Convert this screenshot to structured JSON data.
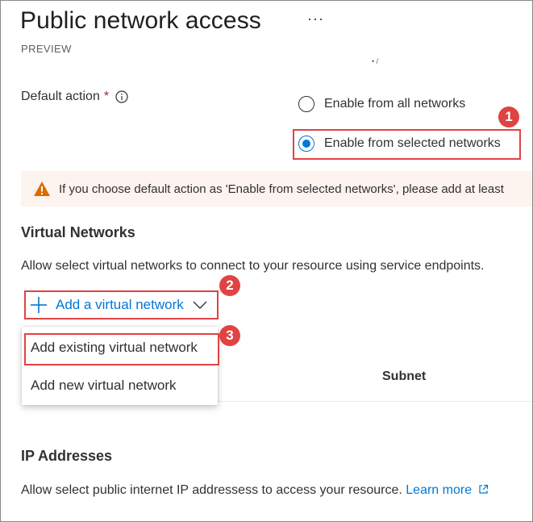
{
  "header": {
    "title": "Public network access",
    "more_label": "···",
    "preview_tag": "PREVIEW"
  },
  "default_action": {
    "label": "Default action",
    "required_mark": "*",
    "options": [
      {
        "label": "Enable from all networks",
        "selected": false
      },
      {
        "label": "Enable from selected networks",
        "selected": true
      }
    ]
  },
  "warning": {
    "text": "If you choose default action as 'Enable from selected networks', please add at least"
  },
  "virtual_networks": {
    "heading": "Virtual Networks",
    "description": "Allow select virtual networks to connect to your resource using service endpoints.",
    "add_button_label": "Add a virtual network",
    "menu_items": [
      "Add existing virtual network",
      "Add new virtual network"
    ],
    "table_column_subnet": "Subnet"
  },
  "ip_addresses": {
    "heading": "IP Addresses",
    "description": "Allow select public internet IP addressess to access your resource.",
    "learn_more": "Learn more"
  },
  "callouts": [
    "1",
    "2",
    "3"
  ],
  "colors": {
    "accent": "#0078d4",
    "callout_red": "#e04343",
    "warning_bg": "#fdf3ef",
    "warning_icon": "#d86c00",
    "required": "#a4262c"
  },
  "icons": [
    "info-icon",
    "warning-icon",
    "plus-icon",
    "chevron-down-icon",
    "external-link-icon"
  ]
}
